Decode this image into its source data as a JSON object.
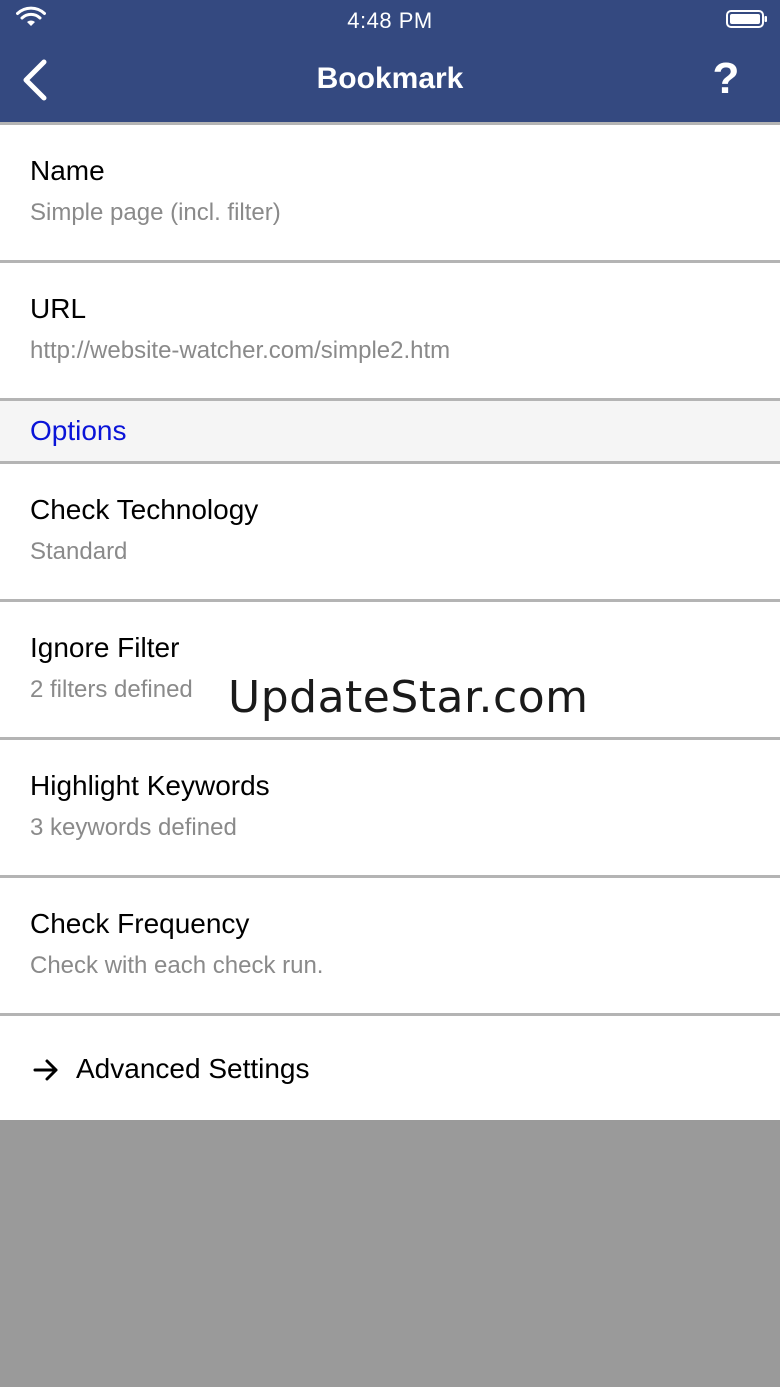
{
  "status_bar": {
    "time": "4:48 PM",
    "wifi_icon": "wifi-icon",
    "battery_icon": "battery-icon"
  },
  "nav": {
    "title": "Bookmark",
    "back_icon": "chevron-left-icon",
    "help_label": "?"
  },
  "rows": [
    {
      "title": "Name",
      "value": "Simple page (incl. filter)"
    },
    {
      "title": "URL",
      "value": "http://website-watcher.com/simple2.htm"
    }
  ],
  "options_section": {
    "label": "Options",
    "rows": [
      {
        "title": "Check Technology",
        "value": "Standard"
      },
      {
        "title": "Ignore Filter",
        "value": "2 filters defined"
      },
      {
        "title": "Highlight Keywords",
        "value": "3 keywords defined"
      },
      {
        "title": "Check Frequency",
        "value": "Check with each check run."
      }
    ]
  },
  "advanced": {
    "label": "Advanced Settings",
    "icon": "arrow-right-icon"
  },
  "watermark": "UpdateStar.com",
  "colors": {
    "nav_background": "#344980",
    "section_label": "#0a14d8",
    "subtitle": "#8a8a8a",
    "empty_area": "#9a9a9a"
  }
}
